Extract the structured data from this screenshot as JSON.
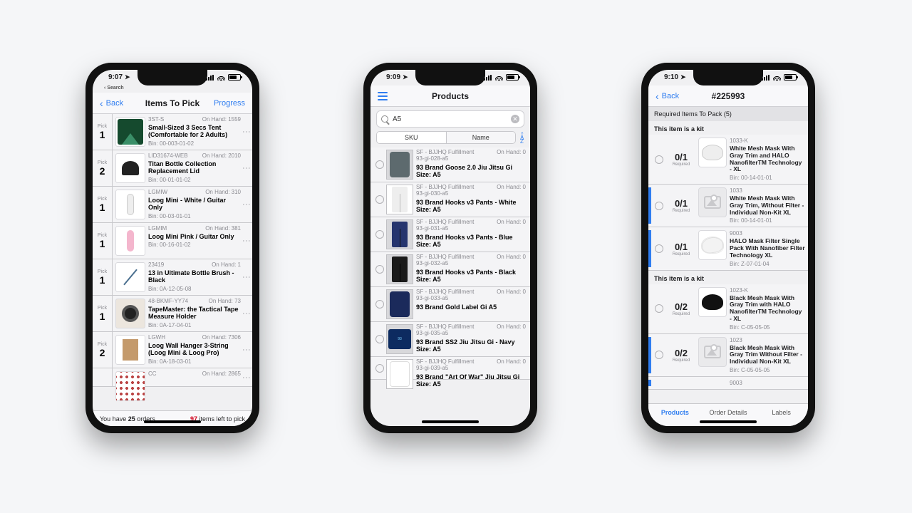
{
  "phone1": {
    "status_time": "9:07",
    "status_crumb": "Search",
    "nav": {
      "back": "Back",
      "title": "Items To Pick",
      "right": "Progress"
    },
    "row_pick_label": "Pick",
    "row_bin_prefix": "Bin:",
    "row_onhand_prefix": "On Hand:",
    "items": [
      {
        "pick_qty": "1",
        "sku": "3ST-S",
        "onhand": "1559",
        "name": "Small-Sized 3 Secs Tent (Comfortable for 2 Adults)",
        "bin": "00-003-01-02",
        "thumb": "tent"
      },
      {
        "pick_qty": "2",
        "sku": "LID31674-WEB",
        "onhand": "2010",
        "name": "Titan Bottle Collection Replacement Lid",
        "bin": "00-01-01-02",
        "thumb": "cap"
      },
      {
        "pick_qty": "1",
        "sku": "LGMIW",
        "onhand": "310",
        "name": "Loog Mini - White / Guitar Only",
        "bin": "00-03-01-01",
        "thumb": "guitar_w"
      },
      {
        "pick_qty": "1",
        "sku": "LGMIM",
        "onhand": "381",
        "name": "Loog Mini Pink / Guitar Only",
        "bin": "00-16-01-02",
        "thumb": "guitar_p"
      },
      {
        "pick_qty": "1",
        "sku": "23419",
        "onhand": "1",
        "name": "13 in Ultimate Bottle Brush - Black",
        "bin": "0A-12-05-08",
        "thumb": "brush"
      },
      {
        "pick_qty": "1",
        "sku": "48-BKMF-YY74",
        "onhand": "73",
        "name": "TapeMaster: the Tactical Tape Measure Holder",
        "bin": "0A-17-04-01",
        "thumb": "tape"
      },
      {
        "pick_qty": "2",
        "sku": "LGWH",
        "onhand": "7306",
        "name": "Loog Wall Hanger 3-String (Loog Mini & Loog Pro)",
        "bin": "0A-18-03-01",
        "thumb": "hanger"
      },
      {
        "pick_qty": "",
        "sku": "CC",
        "onhand": "2865",
        "name": "",
        "bin": "",
        "thumb": "grid"
      }
    ],
    "footer": {
      "have_prefix": "You have ",
      "orders_count": "25",
      "have_suffix": " orders",
      "left_count": "97",
      "left_suffix": " items left to pick"
    }
  },
  "phone2": {
    "status_time": "9:09",
    "nav": {
      "title": "Products"
    },
    "search_value": "A5",
    "seg": {
      "sku": "SKU",
      "name": "Name"
    },
    "onhand_label": "On Hand:",
    "items": [
      {
        "fc": "SF - BJJHQ Fulfillment",
        "sku": "93-gi-028-a5",
        "onhand": "0",
        "name": "93 Brand Goose 2.0 Jiu Jitsu Gi  Size: A5",
        "thumb": "gi1"
      },
      {
        "fc": "SF - BJJHQ Fulfillment",
        "sku": "93-gi-030-a5",
        "onhand": "0",
        "name": "93 Brand Hooks v3 Pants - White Size: A5",
        "thumb": "pants_w"
      },
      {
        "fc": "SF - BJJHQ Fulfillment",
        "sku": "93-gi-031-a5",
        "onhand": "0",
        "name": "93 Brand Hooks v3 Pants - Blue Size: A5",
        "thumb": "pants_b"
      },
      {
        "fc": "SF - BJJHQ Fulfillment",
        "sku": "93-gi-032-a5",
        "onhand": "0",
        "name": "93 Brand Hooks v3 Pants - Black Size: A5",
        "thumb": "pants_k"
      },
      {
        "fc": "SF - BJJHQ Fulfillment",
        "sku": "93-gi-033-a5",
        "onhand": "0",
        "name": "93 Brand Gold Label Gi A5",
        "thumb": "gi2"
      },
      {
        "fc": "SF - BJJHQ Fulfillment",
        "sku": "93-gi-035-a5",
        "onhand": "0",
        "name": "93 Brand SS2 Jiu Jitsu Gi - Navy Size: A5",
        "thumb": "navy"
      },
      {
        "fc": "SF - BJJHQ Fulfillment",
        "sku": "93-gi-039-a5",
        "onhand": "0",
        "name": "93 Brand \"Art Of War\" Jiu Jitsu Gi  Size: A5",
        "thumb": "white"
      }
    ]
  },
  "phone3": {
    "status_time": "9:10",
    "nav": {
      "back": "Back",
      "title": "#225993"
    },
    "required_header": "Required Items To Pack (5)",
    "kit_header": "This item is a kit",
    "required_label": "Required",
    "bin_prefix": "Bin:",
    "group1": [
      {
        "frac": "0/1",
        "sku": "1033-K",
        "name": "White Mesh Mask With Gray Trim and HALO NanofilterTM Technology - XL",
        "bin": "00-14-01-01",
        "thumb": "mask_white",
        "kit": false
      },
      {
        "frac": "0/1",
        "sku": "1033",
        "name": "White Mesh Mask With Gray Trim, Without Filter - Individual Non-Kit XL",
        "bin": "00-14-01-01",
        "thumb": "placeholder",
        "kit": true
      },
      {
        "frac": "0/1",
        "sku": "9003",
        "name": "HALO Mask Filter Single Pack With Nanofiber Filter Technology XL",
        "bin": "Z-07-01-04",
        "thumb": "mask_filter",
        "kit": true
      }
    ],
    "group2": [
      {
        "frac": "0/2",
        "sku": "1023-K",
        "name": "Black Mesh Mask With Gray Trim with HALO NanofilterTM Technology - XL",
        "bin": "C-05-05-05",
        "thumb": "mask_black",
        "kit": false
      },
      {
        "frac": "0/2",
        "sku": "1023",
        "name": "Black Mesh Mask With Gray Trim Without Filter - Individual Non-Kit XL",
        "bin": "C-05-05-05",
        "thumb": "placeholder",
        "kit": true
      },
      {
        "frac": "",
        "sku": "9003",
        "name": "",
        "bin": "",
        "thumb": "none",
        "kit": true
      }
    ],
    "tabs": {
      "products": "Products",
      "details": "Order Details",
      "labels": "Labels"
    }
  }
}
